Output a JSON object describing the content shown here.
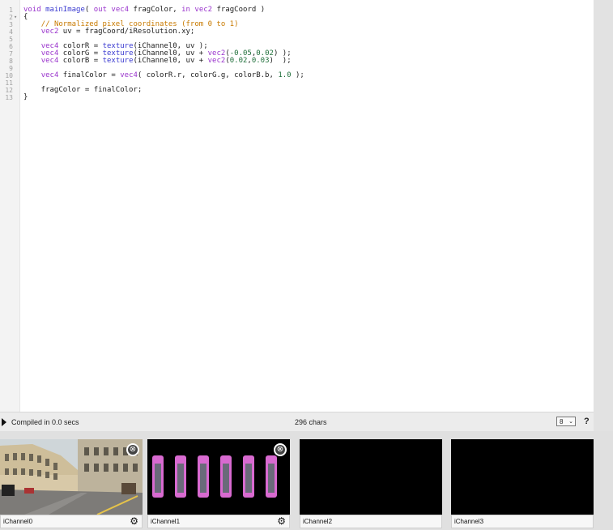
{
  "editor": {
    "line_numbers": [
      "1",
      "2",
      "3",
      "4",
      "5",
      "6",
      "7",
      "8",
      "9",
      "10",
      "11",
      "12",
      "13"
    ],
    "fold_marker": "▾"
  },
  "status": {
    "compiled": "Compiled in 0.0 secs",
    "chars": "296 chars",
    "font_size": "8",
    "help": "?"
  },
  "channels": [
    {
      "label": "iChannel0",
      "has_close": true,
      "has_gear": true,
      "thumb": "street-photo"
    },
    {
      "label": "iChannel1",
      "has_close": true,
      "has_gear": true,
      "thumb": "pink-sprite-strip"
    },
    {
      "label": "iChannel2",
      "has_close": false,
      "has_gear": false,
      "thumb": "empty"
    },
    {
      "label": "iChannel3",
      "has_close": false,
      "has_gear": false,
      "thumb": "empty"
    }
  ],
  "icons": {
    "close": "⊗",
    "gear": "⚙",
    "chevron": "⌄"
  },
  "colors": {
    "keyword": "#9932cc",
    "function": "#3a3ad0",
    "number": "#1f6f3a",
    "comment": "#c87a00"
  }
}
